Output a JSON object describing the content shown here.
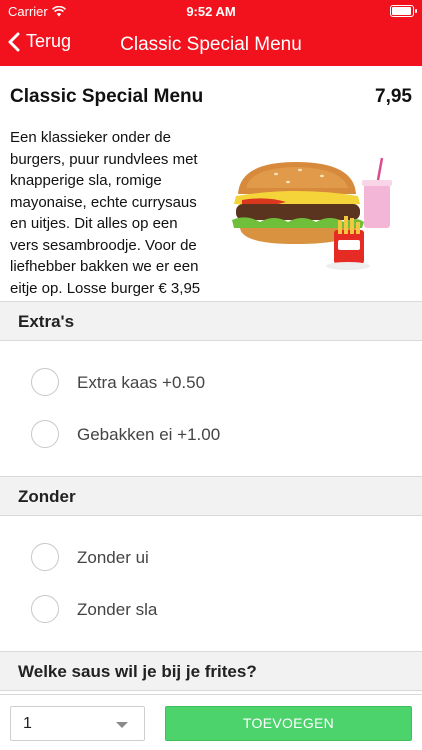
{
  "status_bar": {
    "carrier": "Carrier",
    "time": "9:52 AM"
  },
  "nav": {
    "back_label": "Terug",
    "title": "Classic Special Menu"
  },
  "product": {
    "name": "Classic Special Menu",
    "price": "7,95",
    "description": "Een klassieker onder de burgers, puur rundvlees met knapperige sla, romige mayonaise, echte currysaus en uitjes. Dit alles op een vers sesambroodje. Voor de liefhebber bakken we er een eitje op. Losse burger € 3,95",
    "image_icon": "burger-menu-photo"
  },
  "sections": [
    {
      "title": "Extra's",
      "options": [
        {
          "label": "Extra kaas +0.50",
          "checked": false
        },
        {
          "label": "Gebakken ei +1.00",
          "checked": false
        }
      ]
    },
    {
      "title": "Zonder",
      "options": [
        {
          "label": "Zonder ui",
          "checked": false
        },
        {
          "label": "Zonder sla",
          "checked": false
        }
      ]
    },
    {
      "title": "Welke saus wil je bij je frites?",
      "options": []
    }
  ],
  "footer": {
    "quantity": "1",
    "add_label": "TOEVOEGEN"
  },
  "colors": {
    "brand_red": "#f2121e",
    "add_green": "#4cd36c",
    "section_bg": "#f2f2f2"
  }
}
